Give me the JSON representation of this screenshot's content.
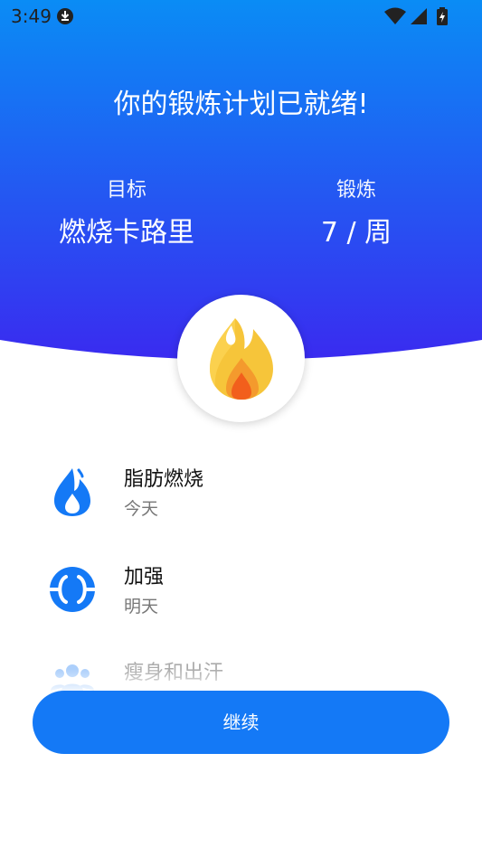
{
  "status_bar": {
    "time": "3:49",
    "icons": [
      "download-icon",
      "wifi-icon",
      "signal-icon",
      "battery-charging-icon"
    ]
  },
  "hero": {
    "title": "你的锻炼计划已就绪!",
    "goal_label": "目标",
    "goal_value": "燃烧卡路里",
    "workout_label": "锻炼",
    "workout_value": "7 / 周",
    "badge_icon": "flame-icon",
    "gradient_colors": [
      "#0a8cf5",
      "#3a2bf0"
    ]
  },
  "plan": {
    "items": [
      {
        "title": "脂肪燃烧",
        "subtitle": "今天",
        "icon": "fat-burn-icon"
      },
      {
        "title": "加强",
        "subtitle": "明天",
        "icon": "strength-icon"
      },
      {
        "title": "瘦身和出汗",
        "subtitle": "",
        "icon": "group-icon"
      }
    ]
  },
  "actions": {
    "continue_label": "继续",
    "accent_color": "#1479f6"
  }
}
